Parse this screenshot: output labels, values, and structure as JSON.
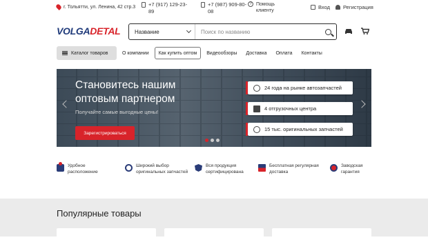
{
  "topbar": {
    "address": "г. Тольятти, ул. Ленина, 42 стр.3",
    "phone1": "+7 (917) 129-23-89",
    "phone2": "+7 (987) 909-80-08",
    "help": "Помощь клиенту",
    "login": "Вход",
    "register": "Регистрация"
  },
  "header": {
    "logo_part1": "VOLGA",
    "logo_part2": "DETAL",
    "search_select": "Название",
    "search_placeholder": "Поиск по названию"
  },
  "nav": {
    "catalog": "Каталог товаров",
    "items": [
      "О компании",
      "Как купить оптом",
      "Видеообзоры",
      "Доставка",
      "Оплата",
      "Контакты"
    ]
  },
  "banner": {
    "title": "Становитесь нашим оптовым партнером",
    "subtitle": "Получайте самые выгодные цены!",
    "button": "Зарегистрироваться",
    "features": [
      "24 года на рынке автозапчастей",
      "4 отгрузочных центра",
      "15 тыс. оригинальных запчастей"
    ]
  },
  "perks": [
    "Удобное расположение",
    "Широкий выбор оригинальных запчастей",
    "Вся продукция сертифицирована",
    "Бесплатная регулярная доставка",
    "Заводская гарантия"
  ],
  "popular": {
    "title": "Популярные товары"
  },
  "colors": {
    "accent": "#d8232a",
    "brand": "#1f3a7a"
  },
  "icons": [
    "location-pin-icon",
    "phone-icon",
    "help-icon",
    "login-icon",
    "user-icon",
    "search-icon",
    "car-icon",
    "cart-icon",
    "menu-icon"
  ]
}
